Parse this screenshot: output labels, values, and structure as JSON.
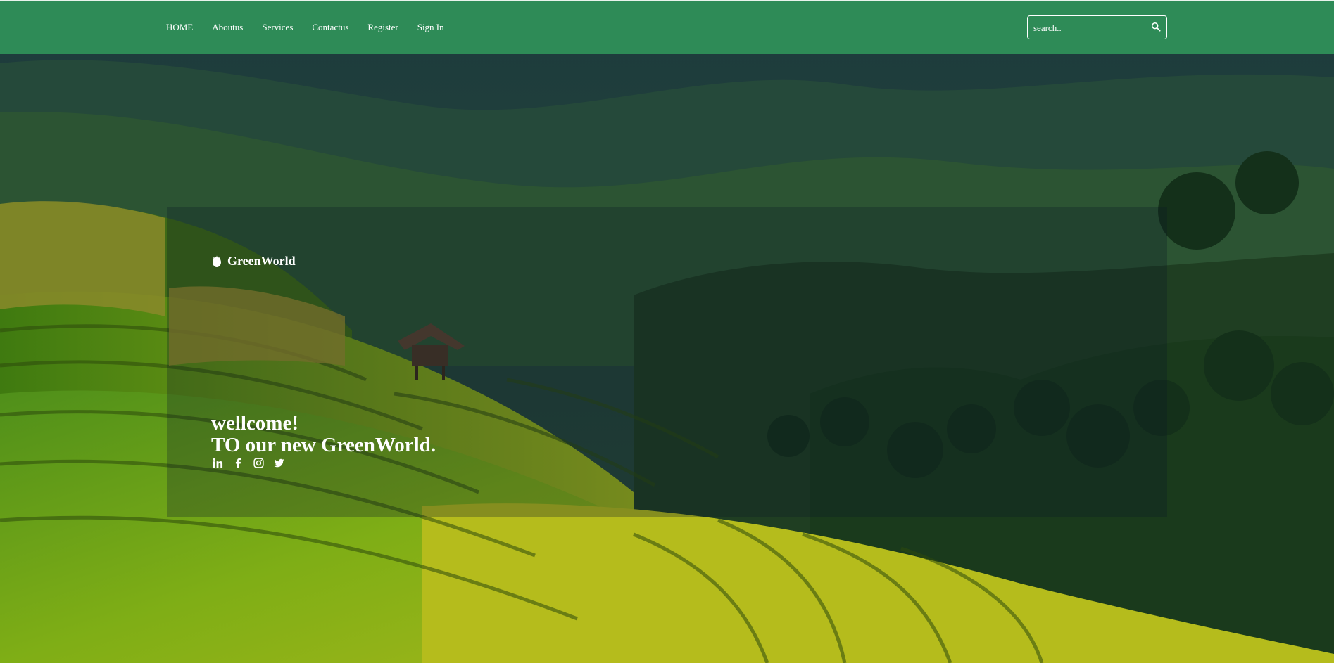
{
  "nav": {
    "links": [
      {
        "label": "HOME"
      },
      {
        "label": "Aboutus"
      },
      {
        "label": "Services"
      },
      {
        "label": "Contactus"
      },
      {
        "label": "Register"
      },
      {
        "label": "Sign In"
      }
    ],
    "search_placeholder": "search.."
  },
  "hero": {
    "brand": "GreenWorld",
    "headline_line1": "wellcome!",
    "headline_line2": "TO our new GreenWorld."
  },
  "social_icons": [
    "linkedin-icon",
    "facebook-icon",
    "instagram-icon",
    "twitter-icon"
  ],
  "colors": {
    "navbar": "#2e8b57",
    "text": "#ffffff"
  }
}
